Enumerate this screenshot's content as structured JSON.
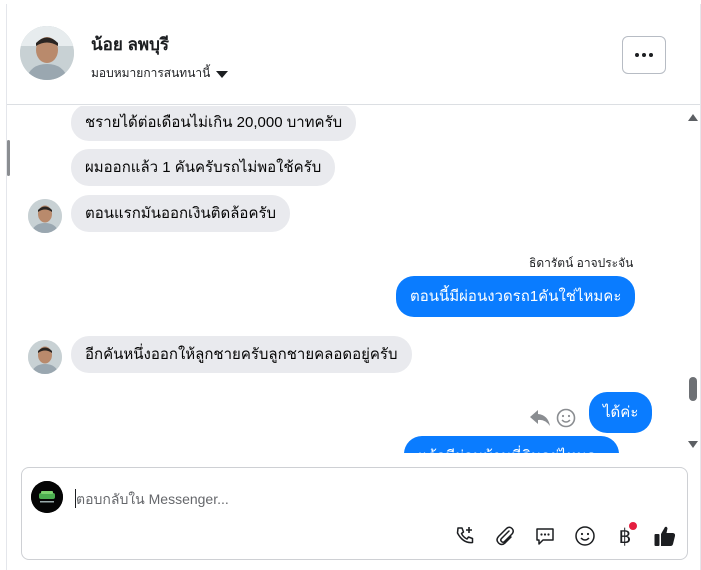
{
  "header": {
    "name": "น้อย ลพบุรี",
    "assign_label": "มอบหมายการสนทนานี้",
    "more_label": "More options"
  },
  "messages": [
    {
      "direction": "in",
      "text": "ชรายได้ต่อเดือนไม่เกิน 20,000 บาทครับ"
    },
    {
      "direction": "in",
      "text": "ผมออกแล้ว 1 คันครับรถไม่พอใช้ครับ"
    },
    {
      "direction": "in",
      "text": "ตอนแรกมันออกเงินติดล้อครับ"
    },
    {
      "direction": "out",
      "sender": "ธิดารัตน์ อาจประจัน",
      "text": "ตอนนี้มีผ่อนงวดรถ1คันใช่ไหมคะ"
    },
    {
      "direction": "in",
      "text": "อีกคันหนึ่งออกให้ลูกชายครับลูกชายคลอดอยู่ครับ"
    },
    {
      "direction": "out",
      "text": "ได้ค่ะ"
    },
    {
      "direction": "out",
      "text": "แล้วมีผ่อนบ้านที่ดินอยู่ไหมคะ"
    }
  ],
  "composer": {
    "placeholder": "ตอบกลับใน Messenger..."
  },
  "toolbar": {
    "icons": [
      "phone-plus-icon",
      "paperclip-icon",
      "saved-reply-icon",
      "emoji-icon",
      "baht-payment-icon",
      "thumbs-up-icon"
    ],
    "baht_symbol": "฿",
    "notification_color": "#e41e3f"
  },
  "colors": {
    "outgoing_bubble": "#0a7cff",
    "incoming_bubble": "#e9eaee",
    "thumbs_up": "#1c1e21"
  }
}
